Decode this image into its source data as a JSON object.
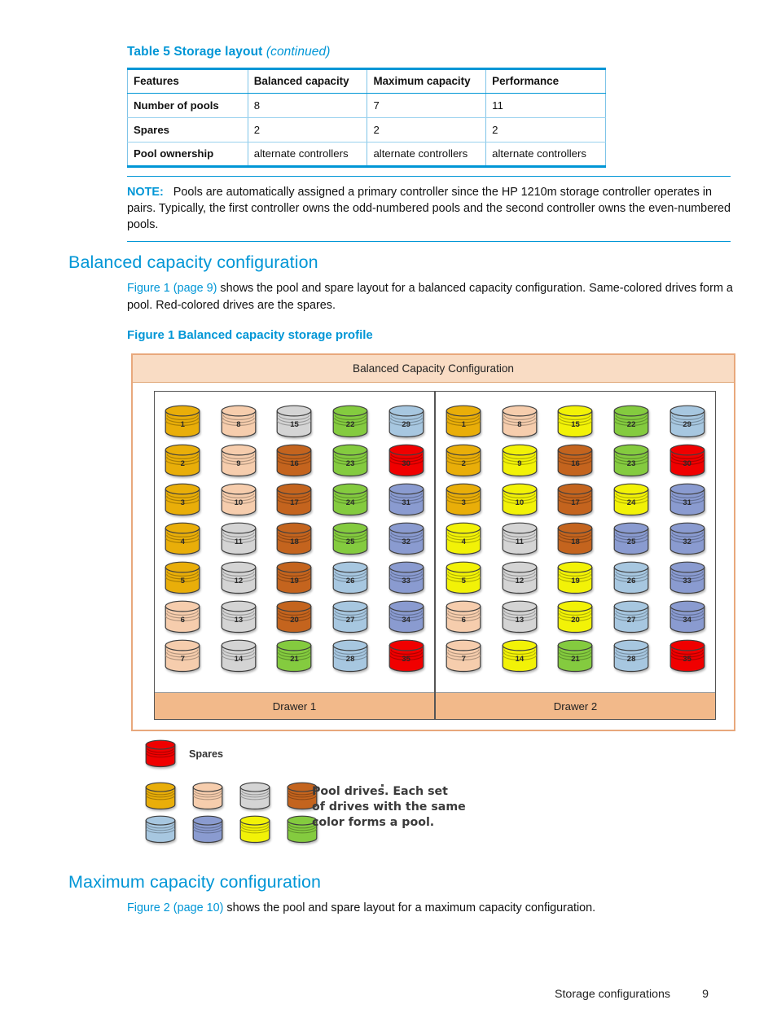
{
  "table": {
    "caption_main": "Table 5 Storage layout ",
    "caption_continued": "(continued)",
    "headers": [
      "Features",
      "Balanced capacity",
      "Maximum capacity",
      "Performance"
    ],
    "rows": [
      {
        "label": "Number of pools",
        "balanced": "8",
        "maximum": "7",
        "performance": "11"
      },
      {
        "label": "Spares",
        "balanced": "2",
        "maximum": "2",
        "performance": "2"
      },
      {
        "label": "Pool ownership",
        "balanced": "alternate controllers",
        "maximum": "alternate controllers",
        "performance": "alternate controllers"
      }
    ]
  },
  "note": {
    "lead": "NOTE:",
    "text": "Pools are automatically assigned a primary controller since the HP 1210m storage controller operates in pairs. Typically, the first controller owns the odd-numbered pools and the second controller owns the even-numbered pools."
  },
  "section_balanced": {
    "heading": "Balanced capacity configuration",
    "link": "Figure 1 (page 9)",
    "body": " shows the pool and spare layout for a balanced capacity configuration. Same-colored drives form a pool. Red-colored drives are the spares."
  },
  "figure": {
    "caption": "Figure 1 Balanced capacity storage profile",
    "title": "Balanced Capacity Configuration",
    "drawer1_label": "Drawer 1",
    "drawer2_label": "Drawer 2"
  },
  "section_maximum": {
    "heading": "Maximum capacity configuration",
    "link": "Figure 2 (page 10)",
    "body": " shows the pool and spare layout for a maximum capacity configuration."
  },
  "legend": {
    "spares_label": "Spares",
    "pool_text_line1": "Pool drives. Each set",
    "pool_text_line2": "of drives with the same",
    "pool_text_line3": "color forms a pool.",
    "pool_colors": [
      "gold",
      "peach",
      "gray",
      "brown",
      "lightblue",
      "periwinkle",
      "yellow",
      "green"
    ],
    "spare_color": "red"
  },
  "footer": {
    "section": "Storage configurations",
    "page": "9"
  },
  "palette": {
    "gold": "#E9AE09",
    "peach": "#F6CDAD",
    "gray": "#D4D4D4",
    "brown": "#C4641E",
    "lightblue": "#A7C7E0",
    "periwinkle": "#8A9BD0",
    "yellow": "#F2F207",
    "green": "#84CB3F",
    "red": "#F00000",
    "accent_blue": "#0096D6",
    "frame_orange": "#E8A87C",
    "title_peach": "#F9DCC4",
    "drawer_peach": "#F2B98A"
  },
  "chart_data": {
    "type": "table",
    "title": "Balanced Capacity Configuration",
    "note": "Each drawer holds 35 drives arranged in 5 columns of 7 rows; drive number and pool color shown.",
    "drawers": [
      {
        "name": "Drawer 1",
        "columns": [
          {
            "drives": [
              {
                "n": "1",
                "color": "gold"
              },
              {
                "n": "2",
                "color": "gold"
              },
              {
                "n": "3",
                "color": "gold"
              },
              {
                "n": "4",
                "color": "gold"
              },
              {
                "n": "5",
                "color": "gold"
              },
              {
                "n": "6",
                "color": "peach"
              },
              {
                "n": "7",
                "color": "peach"
              }
            ]
          },
          {
            "drives": [
              {
                "n": "8",
                "color": "peach"
              },
              {
                "n": "9",
                "color": "peach"
              },
              {
                "n": "10",
                "color": "peach"
              },
              {
                "n": "11",
                "color": "gray"
              },
              {
                "n": "12",
                "color": "gray"
              },
              {
                "n": "13",
                "color": "gray"
              },
              {
                "n": "14",
                "color": "gray"
              }
            ]
          },
          {
            "drives": [
              {
                "n": "15",
                "color": "gray"
              },
              {
                "n": "16",
                "color": "brown"
              },
              {
                "n": "17",
                "color": "brown"
              },
              {
                "n": "18",
                "color": "brown"
              },
              {
                "n": "19",
                "color": "brown"
              },
              {
                "n": "20",
                "color": "brown"
              },
              {
                "n": "21",
                "color": "green"
              }
            ]
          },
          {
            "drives": [
              {
                "n": "22",
                "color": "green"
              },
              {
                "n": "23",
                "color": "green"
              },
              {
                "n": "24",
                "color": "green"
              },
              {
                "n": "25",
                "color": "green"
              },
              {
                "n": "26",
                "color": "lightblue"
              },
              {
                "n": "27",
                "color": "lightblue"
              },
              {
                "n": "28",
                "color": "lightblue"
              }
            ]
          },
          {
            "drives": [
              {
                "n": "29",
                "color": "lightblue"
              },
              {
                "n": "30",
                "color": "red"
              },
              {
                "n": "31",
                "color": "periwinkle"
              },
              {
                "n": "32",
                "color": "periwinkle"
              },
              {
                "n": "33",
                "color": "periwinkle"
              },
              {
                "n": "34",
                "color": "periwinkle"
              },
              {
                "n": "35",
                "color": "red"
              }
            ]
          }
        ]
      },
      {
        "name": "Drawer 2",
        "columns": [
          {
            "drives": [
              {
                "n": "1",
                "color": "gold"
              },
              {
                "n": "2",
                "color": "gold"
              },
              {
                "n": "3",
                "color": "gold"
              },
              {
                "n": "4",
                "color": "yellow"
              },
              {
                "n": "5",
                "color": "yellow"
              },
              {
                "n": "6",
                "color": "peach"
              },
              {
                "n": "7",
                "color": "peach"
              }
            ]
          },
          {
            "drives": [
              {
                "n": "8",
                "color": "peach"
              },
              {
                "n": "9",
                "color": "yellow"
              },
              {
                "n": "10",
                "color": "yellow"
              },
              {
                "n": "11",
                "color": "gray"
              },
              {
                "n": "12",
                "color": "gray"
              },
              {
                "n": "13",
                "color": "gray"
              },
              {
                "n": "14",
                "color": "yellow"
              }
            ]
          },
          {
            "drives": [
              {
                "n": "15",
                "color": "yellow"
              },
              {
                "n": "16",
                "color": "brown"
              },
              {
                "n": "17",
                "color": "brown"
              },
              {
                "n": "18",
                "color": "brown"
              },
              {
                "n": "19",
                "color": "yellow"
              },
              {
                "n": "20",
                "color": "yellow"
              },
              {
                "n": "21",
                "color": "green"
              }
            ]
          },
          {
            "drives": [
              {
                "n": "22",
                "color": "green"
              },
              {
                "n": "23",
                "color": "green"
              },
              {
                "n": "24",
                "color": "yellow"
              },
              {
                "n": "25",
                "color": "periwinkle"
              },
              {
                "n": "26",
                "color": "lightblue"
              },
              {
                "n": "27",
                "color": "lightblue"
              },
              {
                "n": "28",
                "color": "lightblue"
              }
            ]
          },
          {
            "drives": [
              {
                "n": "29",
                "color": "lightblue"
              },
              {
                "n": "30",
                "color": "red"
              },
              {
                "n": "31",
                "color": "periwinkle"
              },
              {
                "n": "32",
                "color": "periwinkle"
              },
              {
                "n": "33",
                "color": "periwinkle"
              },
              {
                "n": "34",
                "color": "periwinkle"
              },
              {
                "n": "35",
                "color": "red"
              }
            ]
          }
        ]
      }
    ]
  }
}
